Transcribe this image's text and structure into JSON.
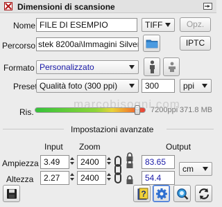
{
  "window": {
    "title": "Dimensioni di scansione"
  },
  "name_row": {
    "label": "Nome",
    "value": "FILE DI ESEMPIO",
    "format": "TIFF",
    "options_button": "Opz."
  },
  "path_row": {
    "label": "Percorso",
    "value": "stek 8200ai\\Immagini Silverfast",
    "iptc_button": "IPTC"
  },
  "format_row": {
    "label": "Formato",
    "value": "Personalizzato",
    "value_color": "#1a1aa8"
  },
  "preset_row": {
    "label": "Preset",
    "value": "Qualità foto (300 ppi)",
    "resolution": "300",
    "unit": "ppi"
  },
  "resolution_row": {
    "label": "Ris.",
    "slider_value": "7200ppi",
    "slider_fraction": 0.95,
    "file_size": "371.8 MB"
  },
  "advanced": {
    "title": "Impostazioni avanzate",
    "col_input": "Input",
    "col_zoom": "Zoom",
    "col_output": "Output",
    "width_label": "Ampiezza",
    "height_label": "Altezza",
    "width_input": "3.49",
    "width_zoom": "2400",
    "width_output": "83.65",
    "height_input": "2.27",
    "height_zoom": "2400",
    "height_output": "54.4",
    "output_unit": "cm",
    "output_color": "#1a1aa8"
  },
  "watermark": "marcobisogni.com"
}
